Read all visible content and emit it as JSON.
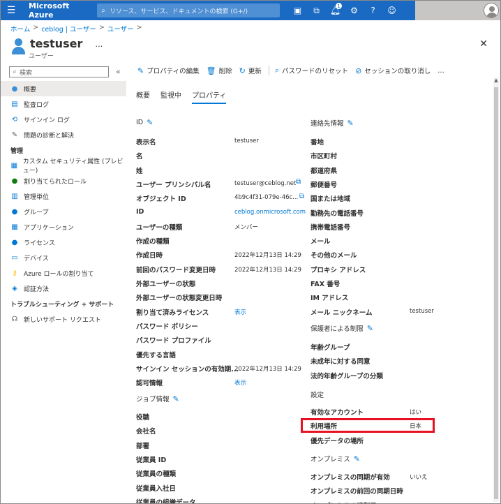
{
  "topbar": {
    "brand": "Microsoft Azure",
    "search_placeholder": "リソース、サービス、ドキュメントの検索 (G+/)",
    "notification_count": "1"
  },
  "breadcrumb": [
    "ホーム",
    "ceblog | ユーザー",
    "ユーザー"
  ],
  "header": {
    "title": "testuser",
    "subtitle": "ユーザー",
    "more": "…"
  },
  "sidebar": {
    "search_placeholder": "検索",
    "items": [
      {
        "label": "概要",
        "icon": "user-icon",
        "active": true
      },
      {
        "label": "監査ログ",
        "icon": "audit-log-icon"
      },
      {
        "label": "サインイン ログ",
        "icon": "signin-log-icon"
      },
      {
        "label": "問題の診断と解決",
        "icon": "wrench-icon"
      }
    ],
    "section_manage": "管理",
    "manage_items": [
      {
        "label": "カスタム セキュリティ属性 (プレビュー)",
        "icon": "custom-attribute-icon"
      },
      {
        "label": "割り当てられたロール",
        "icon": "roles-icon"
      },
      {
        "label": "管理単位",
        "icon": "admin-unit-icon"
      },
      {
        "label": "グループ",
        "icon": "group-icon"
      },
      {
        "label": "アプリケーション",
        "icon": "apps-icon"
      },
      {
        "label": "ライセンス",
        "icon": "license-icon"
      },
      {
        "label": "デバイス",
        "icon": "device-icon"
      },
      {
        "label": "Azure ロールの割り当て",
        "icon": "key-icon"
      },
      {
        "label": "認証方法",
        "icon": "shield-icon"
      }
    ],
    "section_support": "トラブルシューティング + サポート",
    "support_items": [
      {
        "label": "新しいサポート リクエスト",
        "icon": "support-icon"
      }
    ]
  },
  "toolbar": {
    "edit": "プロパティの編集",
    "delete": "削除",
    "refresh": "更新",
    "reset_password": "パスワードのリセット",
    "revoke_sessions": "セッションの取り消し",
    "more": "…"
  },
  "tabs": [
    "概要",
    "監視中",
    "プロパティ"
  ],
  "left": {
    "id_section": "ID",
    "id_props": [
      {
        "label": "表示名",
        "value": "testuser"
      },
      {
        "label": "名",
        "value": ""
      },
      {
        "label": "姓",
        "value": ""
      },
      {
        "label": "ユーザー プリンシパル名",
        "value": "testuser@ceblog.net"
      },
      {
        "label": "オブジェクト ID",
        "value": "4b9c4f31-079e-46c..."
      },
      {
        "label": "ID",
        "value": "ceblog.onmicrosoft.com"
      },
      {
        "label": "ユーザーの種類",
        "value": "メンバー"
      },
      {
        "label": "作成の種類",
        "value": ""
      },
      {
        "label": "作成日時",
        "value": "2022年12月13日 14:29"
      },
      {
        "label": "前回のパスワード変更日時",
        "value": "2022年12月13日 14:29"
      },
      {
        "label": "外部ユーザーの状態",
        "value": ""
      },
      {
        "label": "外部ユーザーの状態変更日時",
        "value": ""
      },
      {
        "label": "割り当て済みライセンス",
        "value": "表示"
      },
      {
        "label": "パスワード ポリシー",
        "value": ""
      },
      {
        "label": "パスワード プロファイル",
        "value": ""
      },
      {
        "label": "優先する言語",
        "value": ""
      },
      {
        "label": "サインイン セッションの有効期...",
        "value": "2022年12月13日 14:29"
      },
      {
        "label": "認可情報",
        "value": "表示"
      }
    ],
    "job_section": "ジョブ情報",
    "job_props": [
      "役職",
      "会社名",
      "部署",
      "従業員 ID",
      "従業員の種類",
      "従業員入社日",
      "従業員の組織データ"
    ]
  },
  "right": {
    "contact_section": "連絡先情報",
    "contact_props": [
      {
        "label": "番地",
        "value": ""
      },
      {
        "label": "市区町村",
        "value": ""
      },
      {
        "label": "都道府県",
        "value": ""
      },
      {
        "label": "郵便番号",
        "value": ""
      },
      {
        "label": "国または地域",
        "value": ""
      },
      {
        "label": "勤務先の電話番号",
        "value": ""
      },
      {
        "label": "携帯電話番号",
        "value": ""
      },
      {
        "label": "メール",
        "value": ""
      },
      {
        "label": "その他のメール",
        "value": ""
      },
      {
        "label": "プロキシ アドレス",
        "value": ""
      },
      {
        "label": "FAX 番号",
        "value": ""
      },
      {
        "label": "IM アドレス",
        "value": ""
      },
      {
        "label": "メール ニックネーム",
        "value": "testuser"
      }
    ],
    "parental_section": "保護者による制限",
    "parental_props": [
      "年齢グループ",
      "未成年に対する同意",
      "法的年齢グループの分類"
    ],
    "settings_section": "設定",
    "settings_props": [
      {
        "label": "有効なアカウント",
        "value": "はい"
      },
      {
        "label": "利用場所",
        "value": "日本"
      },
      {
        "label": "優先データの場所",
        "value": ""
      }
    ],
    "onprem_section": "オンプレミス",
    "onprem_props": [
      {
        "label": "オンプレミスの同期が有効",
        "value": "いいえ"
      },
      {
        "label": "オンプレミスの前回の同期日時",
        "value": ""
      },
      {
        "label": "オンプレミスの識別子",
        "value": ""
      }
    ]
  }
}
